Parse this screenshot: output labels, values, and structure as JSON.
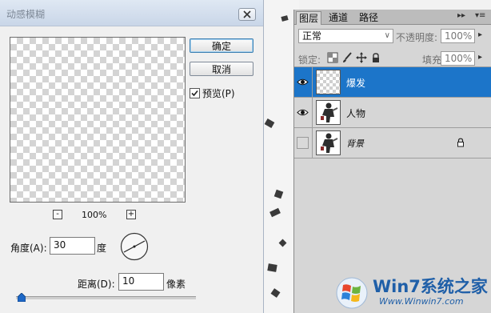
{
  "dialog": {
    "title": "动感模糊",
    "ok_label": "确定",
    "cancel_label": "取消",
    "preview_label": "预览(P)",
    "preview_checked": true,
    "zoom_minus": "-",
    "zoom_plus": "+",
    "zoom_value": "100%",
    "angle_label": "角度(A):",
    "angle_value": "30",
    "angle_unit": "度",
    "distance_label": "距离(D):",
    "distance_value": "10",
    "distance_unit": "像素"
  },
  "layers_panel": {
    "tabs": [
      "图层",
      "通道",
      "路径"
    ],
    "active_tab": 0,
    "blend_mode": "正常",
    "opacity_label": "不透明度:",
    "opacity_value": "100%",
    "lock_label": "锁定:",
    "fill_label": "填充:",
    "fill_value": "100%",
    "layers": [
      {
        "name": "爆发",
        "visible": true,
        "selected": true
      },
      {
        "name": "人物",
        "visible": true,
        "selected": false
      },
      {
        "name": "背景",
        "visible": false,
        "selected": false,
        "locked": true
      }
    ]
  },
  "watermark": {
    "title": "Win7系统之家",
    "url": "Www.Winwin7.com"
  },
  "colors": {
    "selection": "#1c75c9",
    "watermark": "#1f5fa8"
  }
}
